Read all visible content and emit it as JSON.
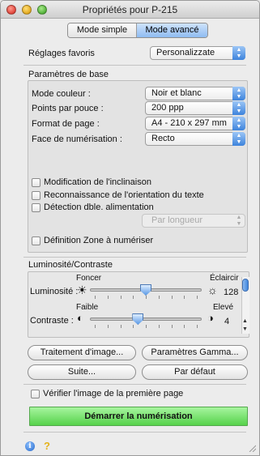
{
  "window": {
    "title": "Propriétés pour P-215"
  },
  "mode_tabs": [
    {
      "label": "Mode simple"
    },
    {
      "label": "Mode avancé"
    }
  ],
  "favoris": {
    "label": "Réglages favoris",
    "value": "Personalizzate"
  },
  "base": {
    "heading": "Paramètres de base",
    "rows": [
      {
        "label": "Mode couleur :",
        "value": "Noir et blanc"
      },
      {
        "label": "Points par pouce :",
        "value": "200 ppp"
      },
      {
        "label": "Format de page :",
        "value": "A4 - 210 x 297 mm"
      },
      {
        "label": "Face de numérisation :",
        "value": "Recto"
      }
    ],
    "checkboxes": [
      {
        "label": "Modification de l'inclinaison",
        "checked": false
      },
      {
        "label": "Reconnaissance de l'orientation du texte",
        "checked": false
      },
      {
        "label": "Détection dble. alimentation",
        "checked": false
      }
    ],
    "double_feed_mode": "Par longueur",
    "zone_checkbox": {
      "label": "Définition Zone à numériser",
      "checked": false
    }
  },
  "lumi": {
    "heading": "Luminosité/Contraste",
    "brightness": {
      "label": "Luminosité :",
      "min_label": "Foncer",
      "max_label": "Éclaircir",
      "value": "128",
      "fraction": 0.5
    },
    "contrast": {
      "label": "Contraste :",
      "min_label": "Faible",
      "max_label": "Elevé",
      "value": "4",
      "fraction": 0.43
    }
  },
  "buttons": {
    "image_processing": "Traitement d'image...",
    "gamma": "Paramètres Gamma...",
    "next": "Suite...",
    "default": "Par défaut",
    "verify_checkbox": "Vérifier l'image de la première page",
    "start": "Démarrer la numérisation"
  },
  "icons": {
    "info": "info-icon",
    "help": "help-icon"
  },
  "colors": {
    "start_button": "#56d24b",
    "accent": "#3d83dc"
  }
}
